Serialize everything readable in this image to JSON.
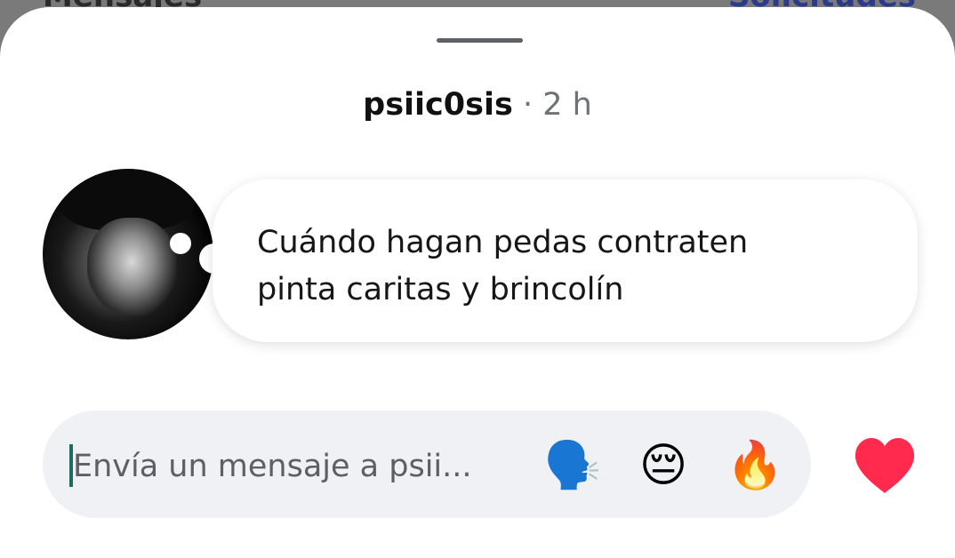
{
  "background_screen": {
    "left_title": "Mensajes",
    "right_link": "Solicitudes"
  },
  "header": {
    "username": "psiic0sis",
    "separator": "·",
    "time": "2 h"
  },
  "message": {
    "line1": "Cuándo hagan pedas contraten",
    "line2": "pinta caritas y brincolín"
  },
  "composer": {
    "placeholder": "Envía un mensaje a psii..."
  },
  "quick_reactions": {
    "speaking": "🗣️",
    "pensive": "😔",
    "fire": "🔥"
  },
  "icons": {
    "like": "heart-icon"
  },
  "colors": {
    "heart": "#ff2a4d",
    "composer_bg": "#eff1f5",
    "caret": "#1b6d5f"
  }
}
